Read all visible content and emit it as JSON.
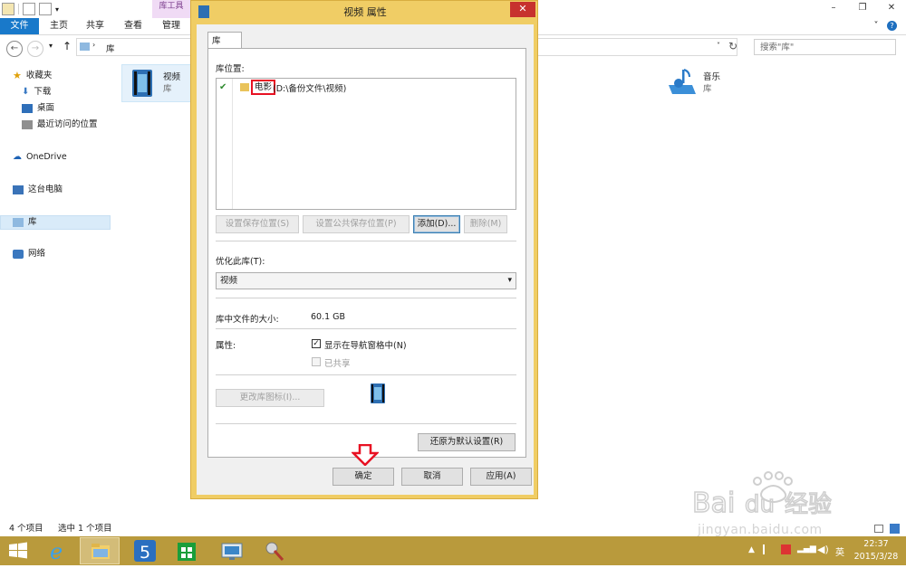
{
  "explorer": {
    "context_tab": "库工具",
    "tabs": [
      "文件",
      "主页",
      "共享",
      "查看",
      "管理"
    ],
    "path": "库",
    "search_placeholder": "搜索\"库\"",
    "nav": {
      "favorites": "收藏夹",
      "downloads": "下载",
      "desktop": "桌面",
      "recent": "最近访问的位置",
      "onedrive": "OneDrive",
      "this_pc": "这台电脑",
      "libraries": "库",
      "network": "网络"
    },
    "tiles": [
      {
        "name": "视频",
        "type": "库"
      },
      {
        "name": "音乐",
        "type": "库"
      }
    ],
    "status": {
      "items": "4 个项目",
      "selected": "选中 1 个项目"
    }
  },
  "dialog": {
    "title": "视频 属性",
    "tab": "库",
    "locations_label": "库位置:",
    "location": {
      "name": "电影",
      "path": "(D:\\备份文件\\视频)"
    },
    "buttons": {
      "set_save": "设置保存位置(S)",
      "set_public": "设置公共保存位置(P)",
      "add": "添加(D)...",
      "remove": "删除(M)",
      "change_icon": "更改库图标(I)...",
      "restore": "还原为默认设置(R)",
      "ok": "确定",
      "cancel": "取消",
      "apply": "应用(A)"
    },
    "optimize_label": "优化此库(T):",
    "optimize_value": "视频",
    "size_label": "库中文件的大小:",
    "size_value": "60.1 GB",
    "attr_label": "属性:",
    "show_in_nav": "显示在导航窗格中(N)",
    "show_in_nav_checked": true,
    "shared": "已共享",
    "shared_checked": false
  },
  "taskbar": {
    "time": "22:37",
    "date": "2015/3/28",
    "ime": "英"
  },
  "watermark": {
    "brand": "Baidu经验",
    "url": "jingyan.baidu.com"
  },
  "colors": {
    "accent": "#1979ca",
    "dialog_frame": "#f0cd65",
    "taskbar": "#b99a3c",
    "close": "#c7322e",
    "highlight": "#e81123"
  }
}
